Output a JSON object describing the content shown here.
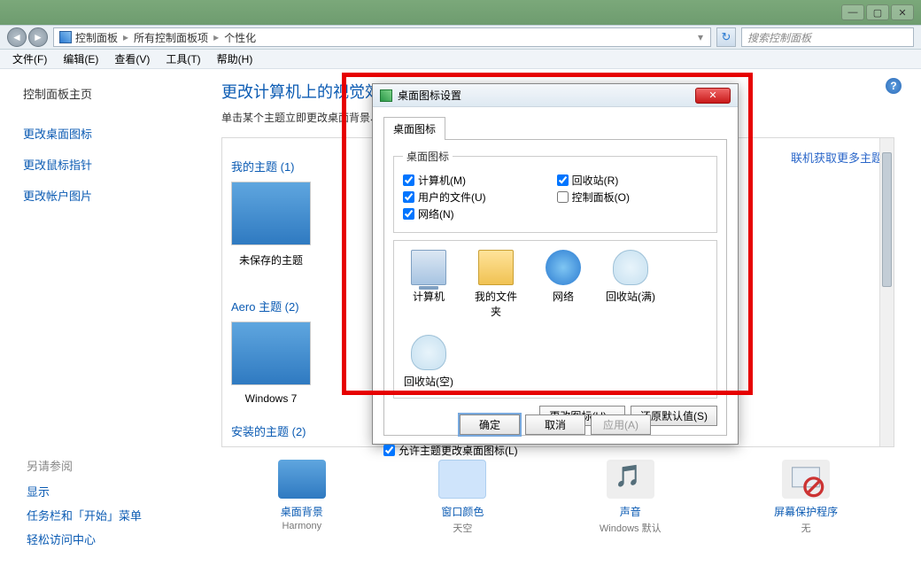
{
  "window": {
    "breadcrumb": [
      "控制面板",
      "所有控制面板项",
      "个性化"
    ],
    "search_placeholder": "搜索控制面板"
  },
  "menu": [
    "文件(F)",
    "编辑(E)",
    "查看(V)",
    "工具(T)",
    "帮助(H)"
  ],
  "sidebar": {
    "home": "控制面板主页",
    "links": [
      "更改桌面图标",
      "更改鼠标指针",
      "更改帐户图片"
    ]
  },
  "seealso": {
    "title": "另请参阅",
    "items": [
      "显示",
      "任务栏和「开始」菜单",
      "轻松访问中心"
    ]
  },
  "main": {
    "heading": "更改计算机上的视觉效果和",
    "subtitle": "单击某个主题立即更改桌面背景、",
    "my_themes_label": "我的主题 (1)",
    "aero_label": "Aero 主题 (2)",
    "installed_label": "安装的主题 (2)",
    "theme1": "未保存的主题",
    "theme2": "Windows 7",
    "get_more": "联机获取更多主题"
  },
  "bottom": {
    "bg": {
      "label": "桌面背景",
      "value": "Harmony"
    },
    "color": {
      "label": "窗口颜色",
      "value": "天空"
    },
    "sound": {
      "label": "声音",
      "value": "Windows 默认"
    },
    "ss": {
      "label": "屏幕保护程序",
      "value": "无"
    }
  },
  "dialog": {
    "title": "桌面图标设置",
    "tab": "桌面图标",
    "legend": "桌面图标",
    "cb_computer": "计算机(M)",
    "cb_userfiles": "用户的文件(U)",
    "cb_network": "网络(N)",
    "cb_recycle": "回收站(R)",
    "cb_cpl": "控制面板(O)",
    "icons": [
      "计算机",
      "我的文件夹",
      "网络",
      "回收站(满)",
      "回收站(空)"
    ],
    "change_icon": "更改图标(H)...",
    "restore": "还原默认值(S)",
    "allow_themes": "允许主题更改桌面图标(L)",
    "ok": "确定",
    "cancel": "取消",
    "apply": "应用(A)"
  }
}
